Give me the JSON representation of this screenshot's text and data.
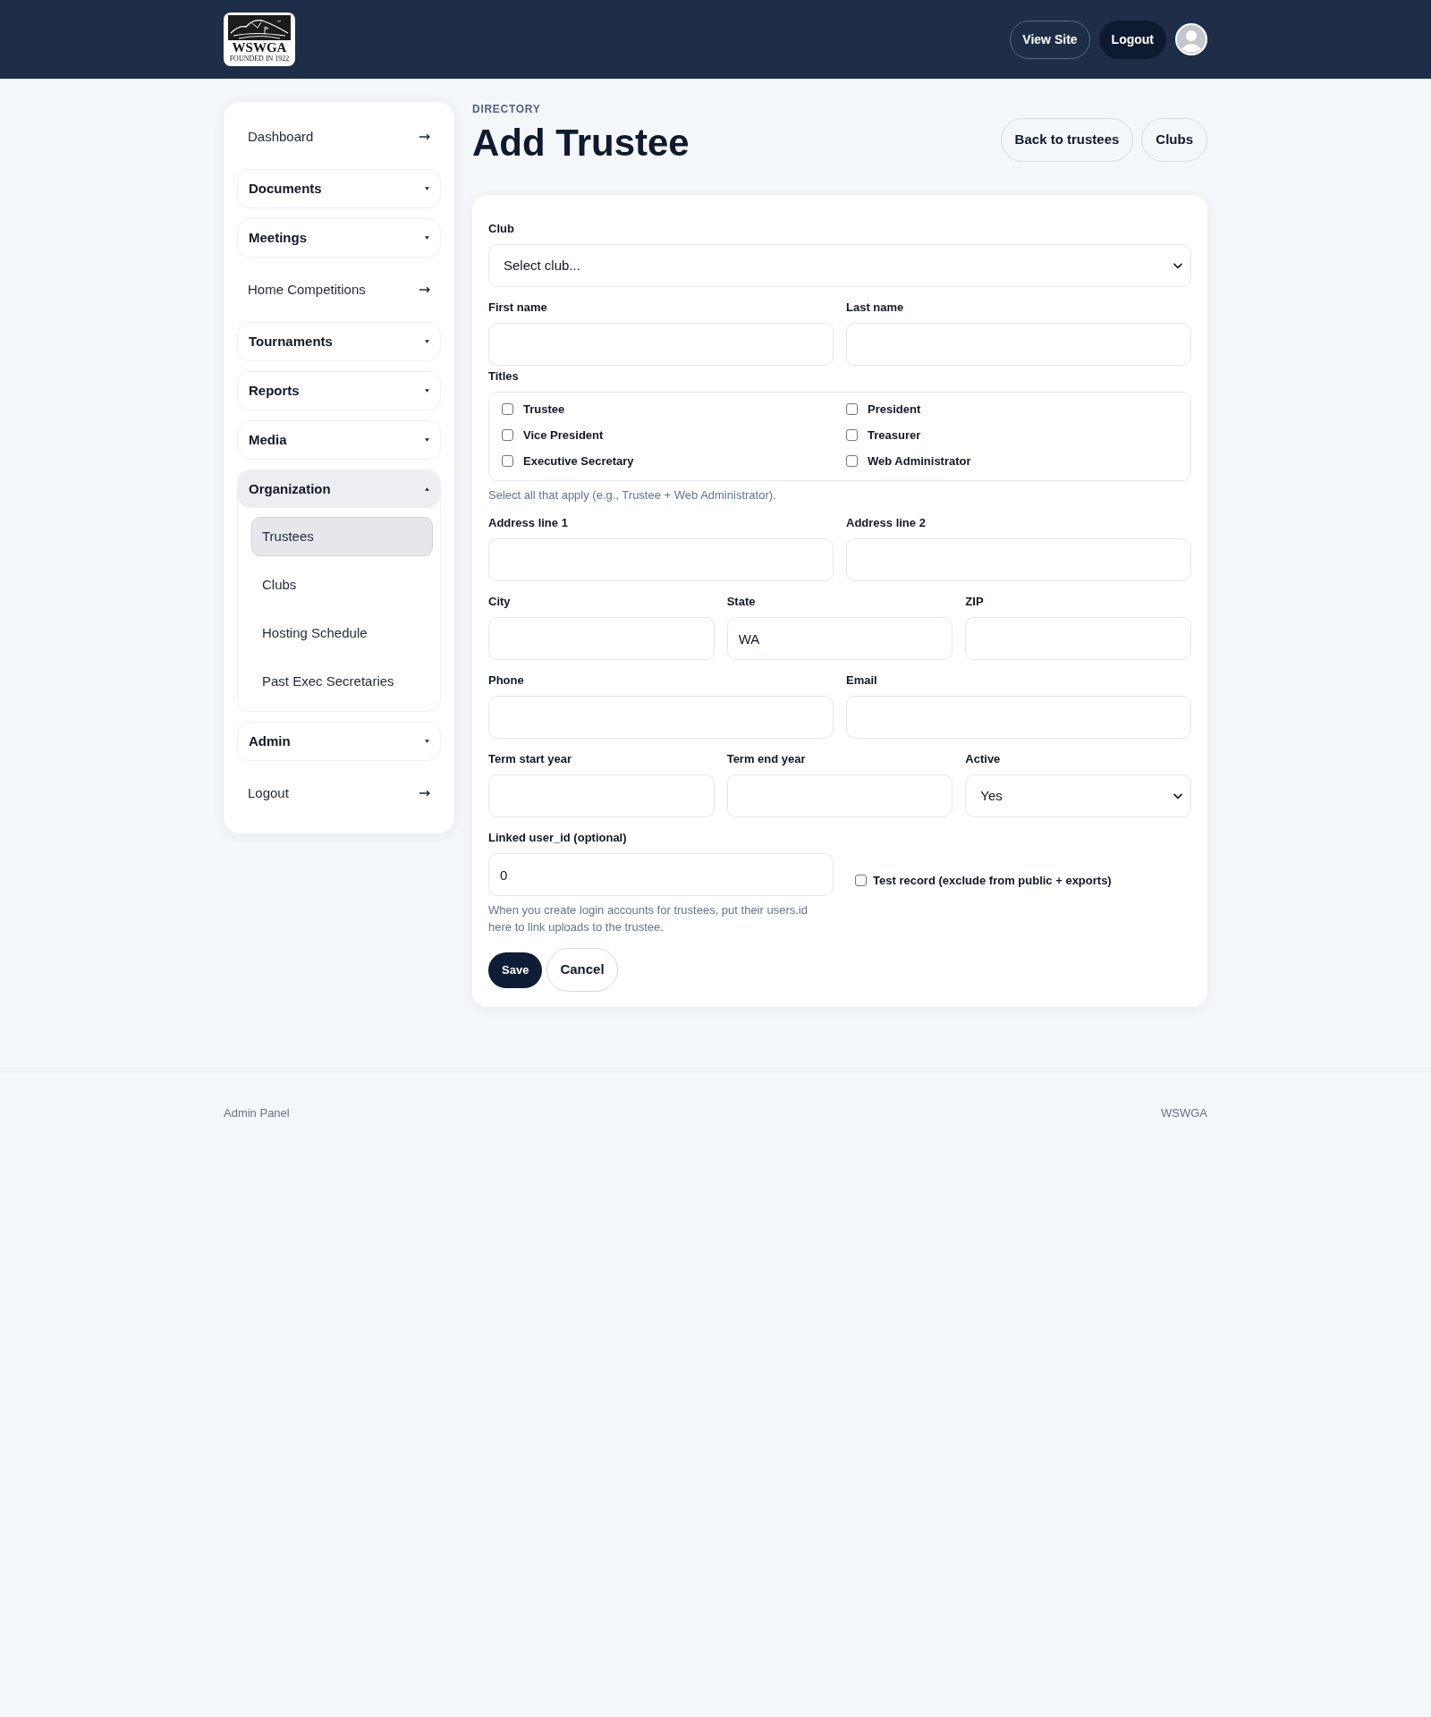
{
  "header": {
    "logo": {
      "wordmark": "WSWGA",
      "tagline": "FOUNDED IN 1922"
    },
    "buttons": [
      {
        "label": "View Site",
        "kind": "outline"
      },
      {
        "label": "Logout",
        "kind": "solid"
      }
    ]
  },
  "sidebar": {
    "items": [
      {
        "kind": "link",
        "label": "Dashboard"
      },
      {
        "kind": "group",
        "label": "Documents",
        "expanded": false
      },
      {
        "kind": "group",
        "label": "Meetings",
        "expanded": false
      },
      {
        "kind": "link",
        "label": "Home Competitions"
      },
      {
        "kind": "group",
        "label": "Tournaments",
        "expanded": false
      },
      {
        "kind": "group",
        "label": "Reports",
        "expanded": false
      },
      {
        "kind": "group",
        "label": "Media",
        "expanded": false
      },
      {
        "kind": "group",
        "label": "Organization",
        "expanded": true,
        "children": [
          {
            "label": "Trustees",
            "selected": true
          },
          {
            "label": "Clubs",
            "selected": false
          },
          {
            "label": "Hosting Schedule",
            "selected": false
          },
          {
            "label": "Past Exec Secretaries",
            "selected": false
          }
        ]
      },
      {
        "kind": "group",
        "label": "Admin",
        "expanded": false
      },
      {
        "kind": "link",
        "label": "Logout"
      }
    ]
  },
  "page_header": {
    "eyebrow": "DIRECTORY",
    "title": "Add Trustee",
    "actions": [
      "Back to trustees",
      "Clubs"
    ]
  },
  "form": {
    "sections": [
      {
        "kind": "fields",
        "fields": [
          {
            "kind": "select",
            "label": "Club",
            "value": "Select club..."
          }
        ]
      },
      {
        "kind": "fields",
        "fields": [
          {
            "kind": "input",
            "label": "First name"
          },
          {
            "kind": "input",
            "label": "Last name"
          }
        ]
      },
      {
        "kind": "checkboxes",
        "label": "Titles",
        "options": [
          {
            "label": "Trustee",
            "checked": false
          },
          {
            "label": "President",
            "checked": false
          },
          {
            "label": "Vice President",
            "checked": false
          },
          {
            "label": "Treasurer",
            "checked": false
          },
          {
            "label": "Executive Secretary",
            "checked": false
          },
          {
            "label": "Web Administrator",
            "checked": false
          }
        ],
        "hint": "Select all that apply (e.g., Trustee + Web Administrator)."
      },
      {
        "kind": "fields",
        "fields": [
          {
            "kind": "input",
            "label": "Address line 1"
          },
          {
            "kind": "input",
            "label": "Address line 2"
          }
        ]
      },
      {
        "kind": "fields",
        "fields": [
          {
            "kind": "input",
            "label": "City"
          },
          {
            "kind": "input",
            "label": "State",
            "value": "WA"
          },
          {
            "kind": "input",
            "label": "ZIP"
          }
        ]
      },
      {
        "kind": "fields",
        "fields": [
          {
            "kind": "input",
            "label": "Phone"
          },
          {
            "kind": "input",
            "label": "Email"
          }
        ]
      },
      {
        "kind": "fields",
        "fields": [
          {
            "kind": "input",
            "label": "Term start year"
          },
          {
            "kind": "input",
            "label": "Term end year"
          },
          {
            "kind": "select",
            "label": "Active",
            "value": "Yes"
          }
        ]
      },
      {
        "kind": "linked",
        "field": {
          "kind": "input",
          "label": "Linked user_id (optional)",
          "value": "0"
        },
        "hint": "When you create login accounts for trustees, put their users.id here to link uploads to the trustee.",
        "checkbox": {
          "label": "Test record (exclude from public + exports)",
          "checked": false
        }
      }
    ],
    "buttons": [
      {
        "label": "Save",
        "kind": "primary"
      },
      {
        "label": "Cancel",
        "kind": "secondary"
      }
    ]
  },
  "footer": {
    "left": "Admin Panel",
    "right": "WSWGA"
  }
}
